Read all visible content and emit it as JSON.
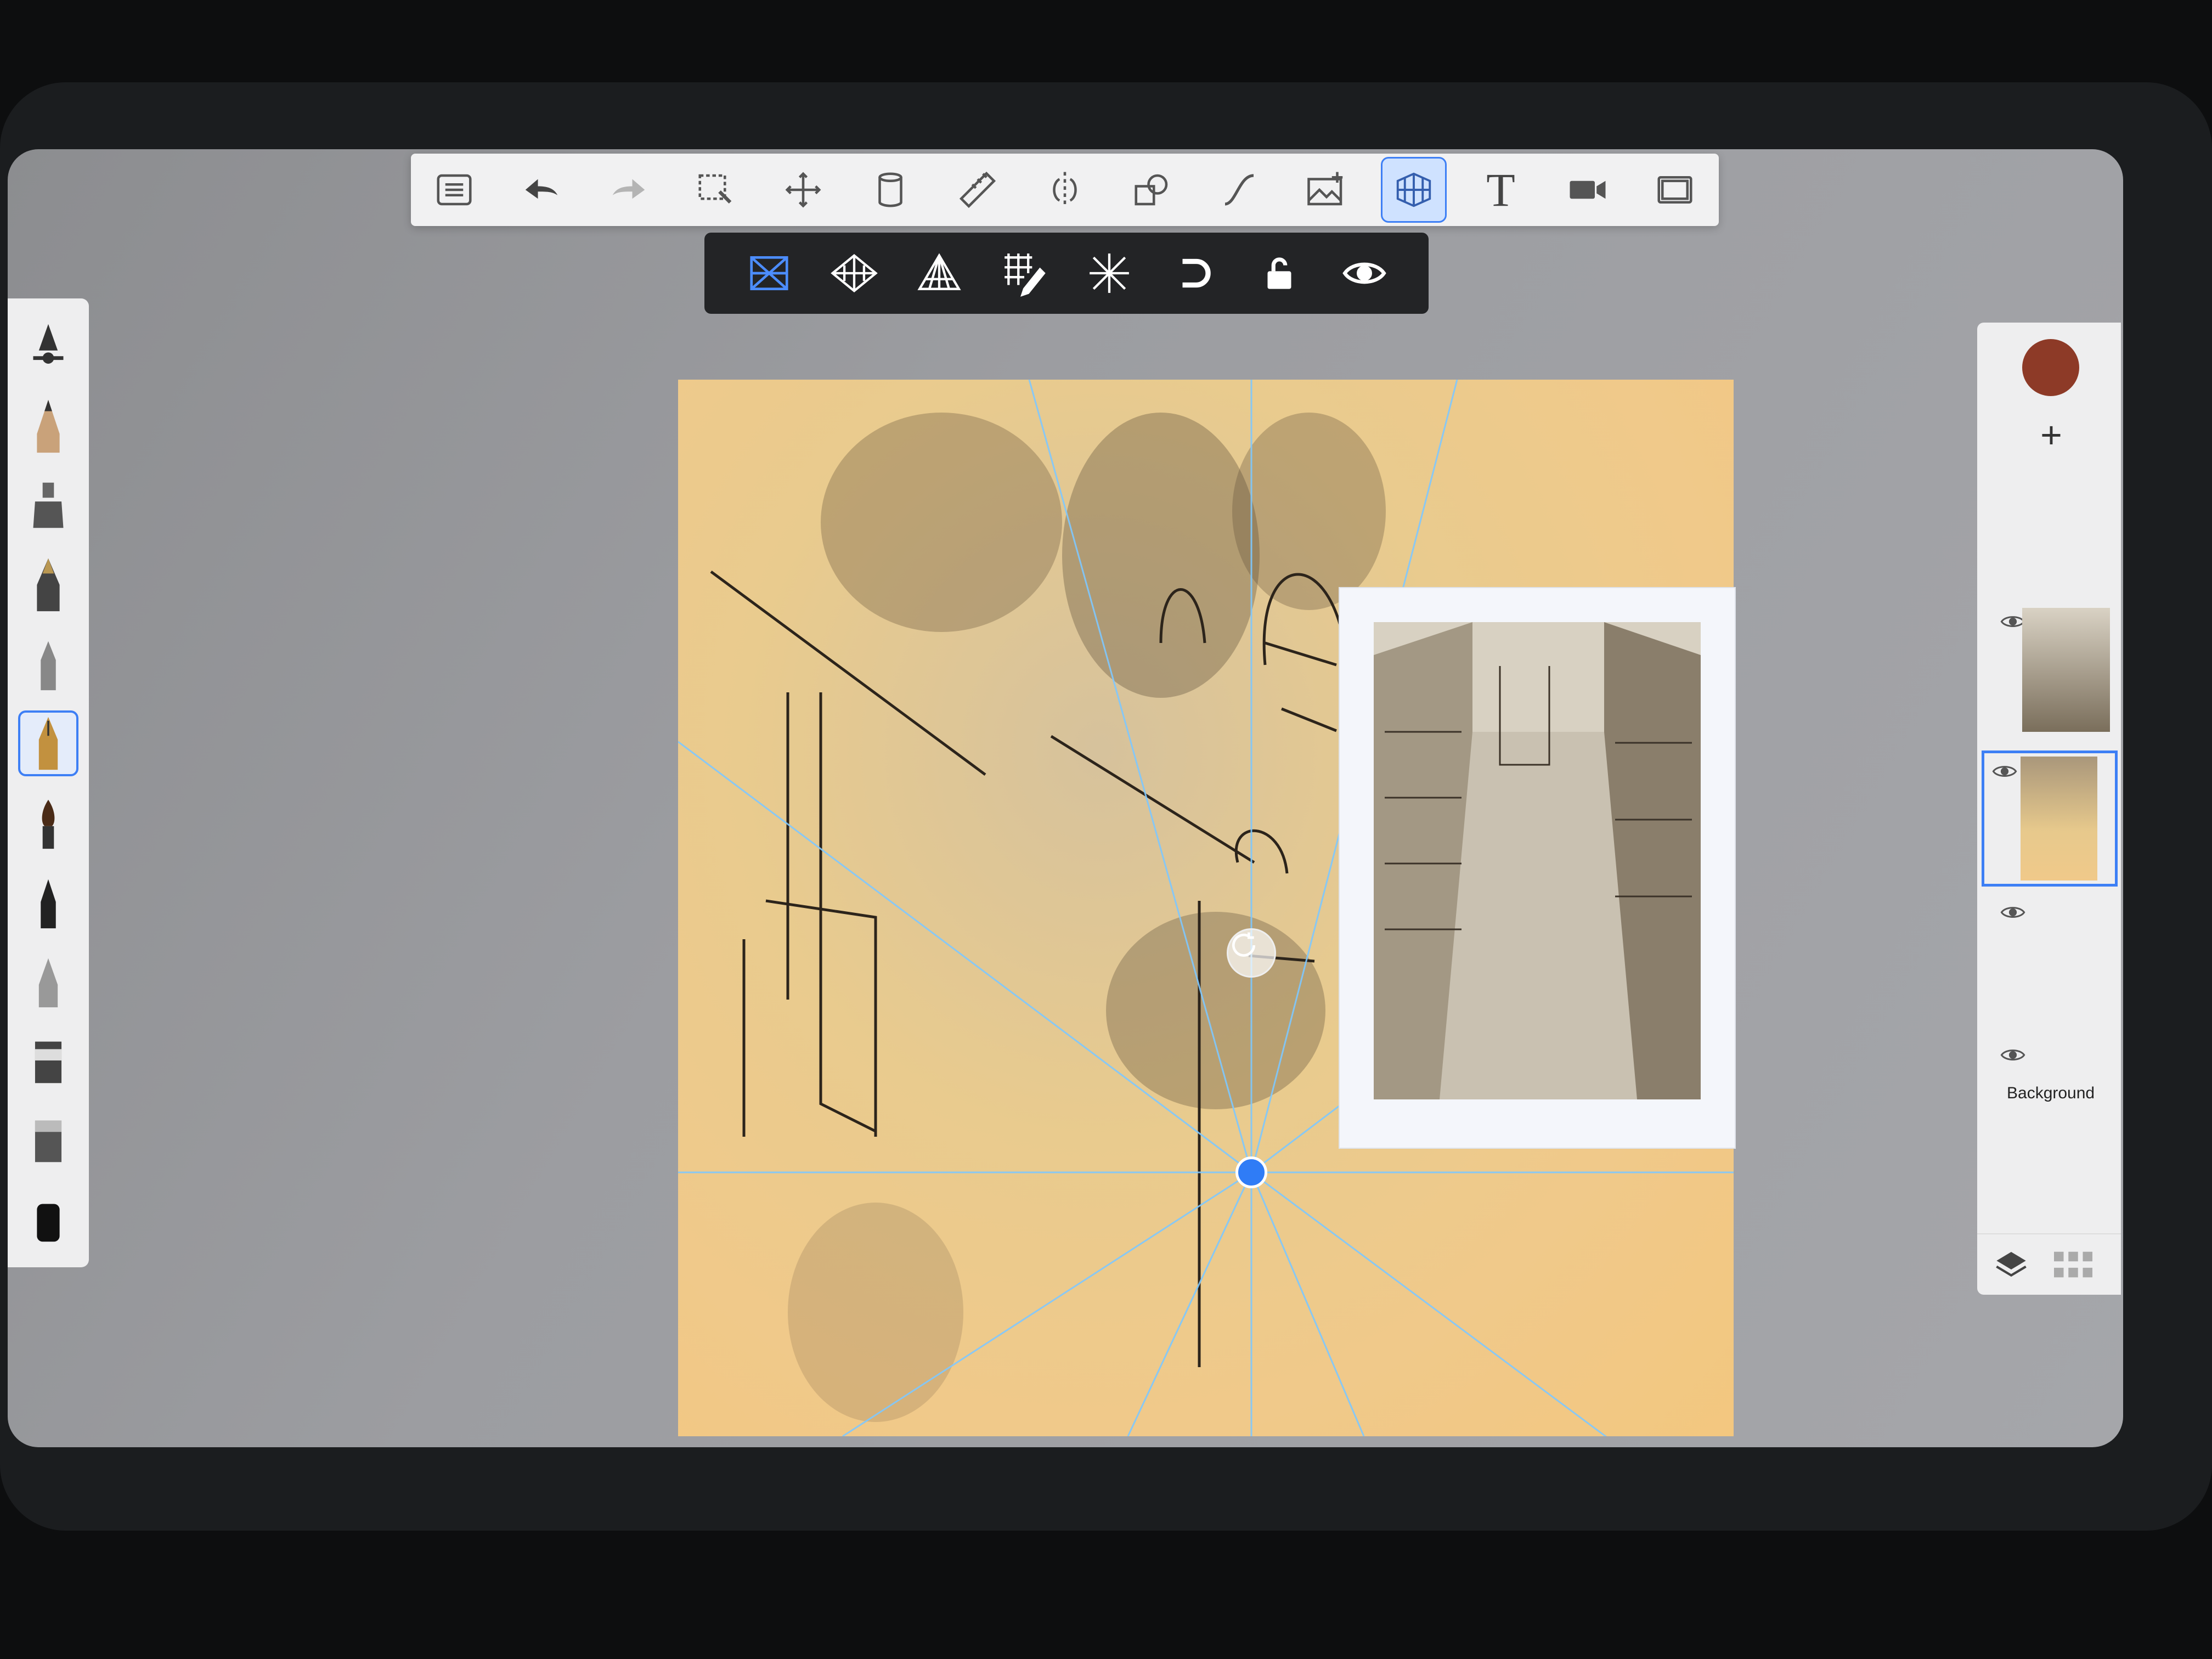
{
  "app": {
    "accent_color": "#3d7ff5",
    "primary_color": "#8d3a27"
  },
  "toolbar": {
    "items": [
      {
        "icon": "list-icon",
        "name": "menu-button"
      },
      {
        "icon": "undo-icon",
        "name": "undo-button"
      },
      {
        "icon": "redo-icon",
        "name": "redo-button",
        "disabled": true
      },
      {
        "icon": "selection-icon",
        "name": "selection-button"
      },
      {
        "icon": "transform-icon",
        "name": "transform-button"
      },
      {
        "icon": "fill-icon",
        "name": "fill-button"
      },
      {
        "icon": "ruler-icon",
        "name": "ruler-button"
      },
      {
        "icon": "symmetry-icon",
        "name": "symmetry-button"
      },
      {
        "icon": "shapes-icon",
        "name": "shapes-button"
      },
      {
        "icon": "curve-icon",
        "name": "curve-button"
      },
      {
        "icon": "image-icon",
        "name": "import-image-button"
      },
      {
        "icon": "perspective-grid-icon",
        "name": "perspective-button",
        "active": true
      },
      {
        "icon": "text-icon",
        "name": "text-button",
        "label": "T"
      },
      {
        "icon": "video-icon",
        "name": "record-button"
      },
      {
        "icon": "fullscreen-icon",
        "name": "fullscreen-button"
      }
    ]
  },
  "perspective_toolbar": {
    "items": [
      {
        "icon": "one-point-icon",
        "name": "one-point-perspective",
        "active": true
      },
      {
        "icon": "two-point-icon",
        "name": "two-point-perspective"
      },
      {
        "icon": "three-point-icon",
        "name": "three-point-perspective"
      },
      {
        "icon": "grid-pencil-icon",
        "name": "edit-grid"
      },
      {
        "icon": "radial-icon",
        "name": "radial-guides"
      },
      {
        "icon": "magnet-icon",
        "name": "snap-toggle"
      },
      {
        "icon": "lock-icon",
        "name": "lock-toggle"
      },
      {
        "icon": "eye-icon",
        "name": "visibility-toggle"
      }
    ]
  },
  "brushes": {
    "items": [
      {
        "name": "brush-size-slider"
      },
      {
        "name": "brush-pencil"
      },
      {
        "name": "brush-marker"
      },
      {
        "name": "brush-ink-pen"
      },
      {
        "name": "brush-fineliner"
      },
      {
        "name": "brush-fountain-pen",
        "active": true
      },
      {
        "name": "brush-paintbrush"
      },
      {
        "name": "brush-felt-tip"
      },
      {
        "name": "brush-airbrush"
      },
      {
        "name": "brush-smudge"
      },
      {
        "name": "brush-blender"
      },
      {
        "name": "brush-eraser"
      }
    ]
  },
  "layers": {
    "color_hex": "#8d3a27",
    "add_label": "+",
    "items": [
      {
        "name": "layer-reference-photo",
        "visible": true
      },
      {
        "name": "layer-sketch",
        "visible": true,
        "selected": true
      },
      {
        "name": "layer-empty",
        "visible": true
      },
      {
        "name": "layer-background",
        "visible": true,
        "label": "Background"
      }
    ]
  }
}
